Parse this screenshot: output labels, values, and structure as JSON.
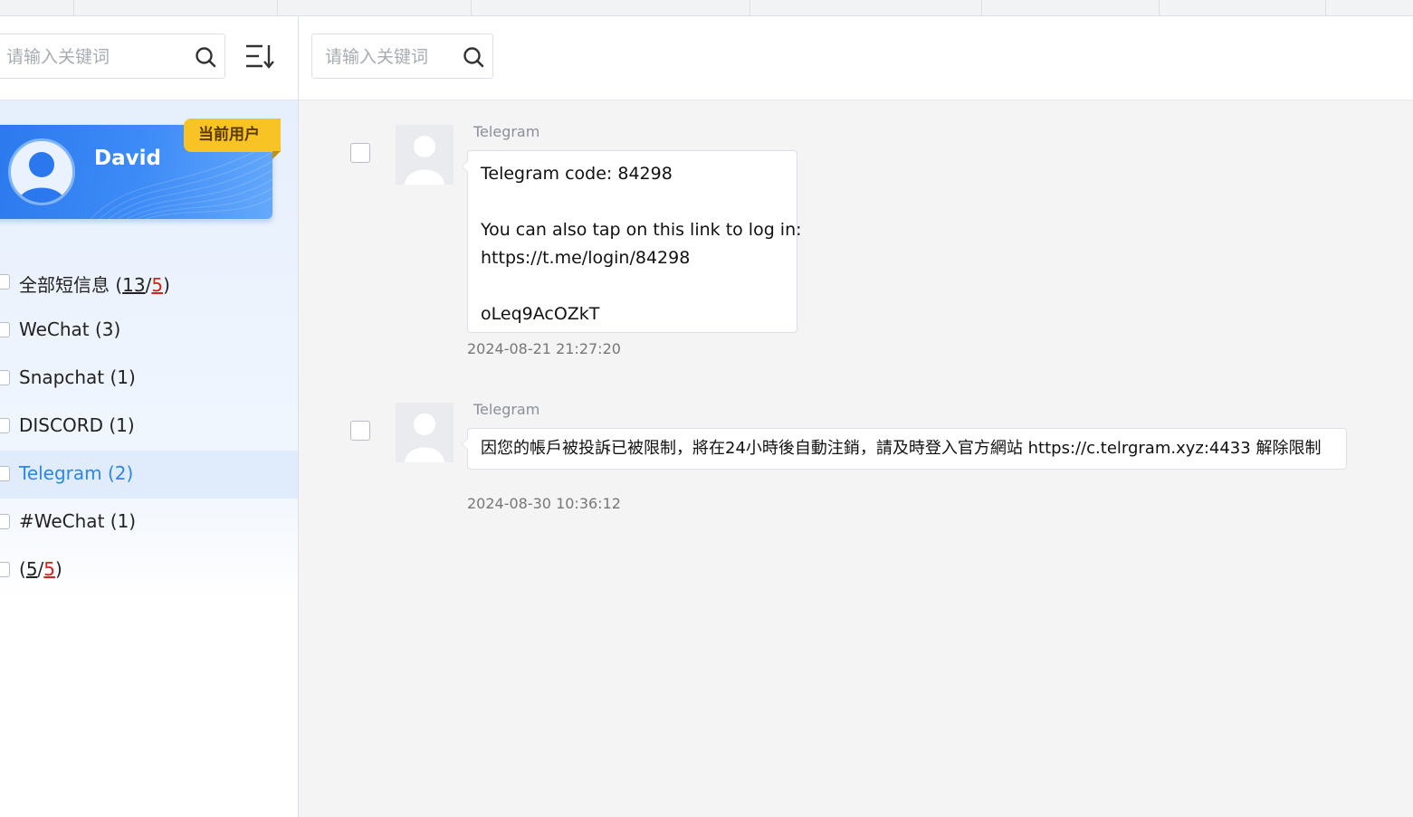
{
  "sidebar": {
    "search": {
      "placeholder": "请输入关键词"
    },
    "user": {
      "name": "David",
      "badge": "当前用户"
    },
    "items": [
      {
        "label": "全部短信息",
        "count_total": "13",
        "count_unread": "5"
      },
      {
        "label": "WeChat (3)"
      },
      {
        "label": "Snapchat (1)"
      },
      {
        "label": "DISCORD (1)"
      },
      {
        "label": "Telegram (2)"
      },
      {
        "label": "#WeChat (1)"
      },
      {
        "label": "",
        "count_total": "5",
        "count_unread": "5"
      }
    ],
    "active_index": 4
  },
  "main": {
    "search": {
      "placeholder": "请输入关键词"
    },
    "messages": [
      {
        "sender": "Telegram",
        "lines": [
          "Telegram code: 84298",
          "",
          "You can also tap on this link to log in:",
          "https://t.me/login/84298",
          "",
          "oLeq9AcOZkT"
        ],
        "time": "2024-08-21 21:27:20"
      },
      {
        "sender": "Telegram",
        "lines": [
          "因您的帳戶被投訴已被限制，將在24小時後自動注銷，請及時登入官方網站 https://c.telrgram.xyz:4433 解除限制"
        ],
        "time": "2024-08-30 10:36:12"
      }
    ]
  },
  "colors": {
    "accent": "#2d86e8",
    "card_blue": "#3e8cf7",
    "badge_yellow": "#f7c325",
    "unread_red": "#d6201d"
  },
  "icons": [
    "search-icon",
    "sort-descending-icon",
    "user-avatar-icon",
    "placeholder-avatar-icon"
  ]
}
